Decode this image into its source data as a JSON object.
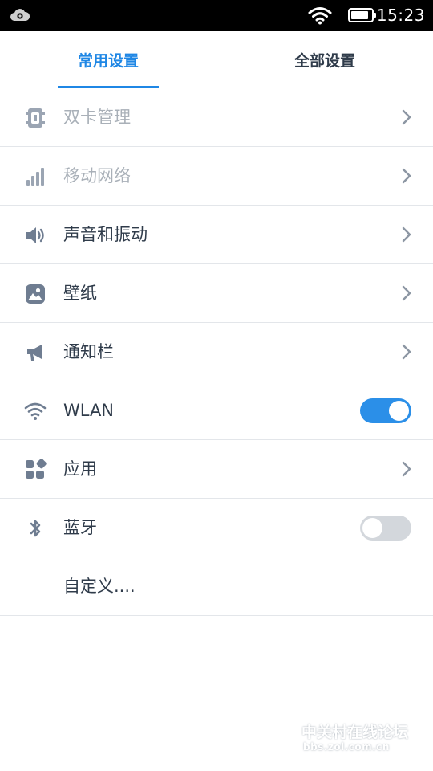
{
  "status_bar": {
    "time": "15:23",
    "left_icon": "cloud-eye-icon",
    "wifi_icon": "wifi-icon",
    "battery_icon": "battery-icon"
  },
  "tabs": [
    {
      "label": "常用设置",
      "active": true
    },
    {
      "label": "全部设置",
      "active": false
    }
  ],
  "colors": {
    "accent": "#1f87e5",
    "text": "#2f3b4a",
    "disabled_text": "#a9b0b8",
    "toggle_off": "#d3d7dc",
    "icon": "#6f7d91"
  },
  "items": [
    {
      "label": "双卡管理",
      "icon": "dual-sim-icon",
      "control": "chevron",
      "enabled": false
    },
    {
      "label": "移动网络",
      "icon": "signal-bars-icon",
      "control": "chevron",
      "enabled": false
    },
    {
      "label": "声音和振动",
      "icon": "speaker-icon",
      "control": "chevron",
      "enabled": true
    },
    {
      "label": "壁纸",
      "icon": "wallpaper-icon",
      "control": "chevron",
      "enabled": true
    },
    {
      "label": "通知栏",
      "icon": "megaphone-icon",
      "control": "chevron",
      "enabled": true
    },
    {
      "label": "WLAN",
      "icon": "wifi-icon",
      "control": "toggle",
      "toggle_on": true,
      "enabled": true
    },
    {
      "label": "应用",
      "icon": "apps-grid-icon",
      "control": "chevron",
      "enabled": true
    },
    {
      "label": "蓝牙",
      "icon": "bluetooth-icon",
      "control": "toggle",
      "toggle_on": false,
      "enabled": true
    },
    {
      "label": "自定义....",
      "icon": "",
      "control": "none",
      "enabled": true
    }
  ],
  "watermark": {
    "line1": "中关村在线论坛",
    "line2": "bbs.zol.com.cn"
  }
}
